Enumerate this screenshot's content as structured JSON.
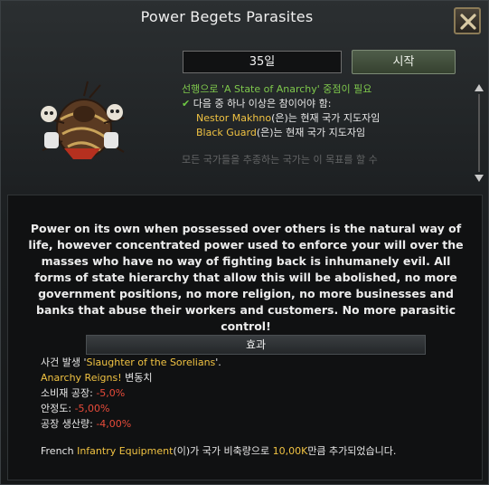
{
  "window": {
    "title": "Power Begets Parasites"
  },
  "header": {
    "days": "35일",
    "start_label": "시작"
  },
  "requirements": {
    "line1": "선행으로 'A State of Anarchy' 중점이 필요",
    "line2_check": "✔",
    "line2": "다음 중 하나 이상은 참이어야 함:",
    "cond1_name": "Nestor Makhno",
    "cond1_rest": "(은)는 현재 국가 지도자임",
    "cond2_name": "Black Guard",
    "cond2_rest": "(은)는 현재 국가 지도자임",
    "cut_text": "모든 국가들을 추종하는 국가는 이 목표를 할 수"
  },
  "description": "Power on its own when possessed over others is the natural way of life, however concentrated power used to enforce your will over the masses who have no way of fighting back is inhumanely evil. All forms of state hierarchy that allow this will be abolished, no more government positions, no more religion, no more businesses and banks that abuse their workers and customers. No more parasitic control!",
  "effects": {
    "header": "효과",
    "event_prefix": "사건 발생 '",
    "event_name": "Slaughter of the Sorelians",
    "event_suffix": "'.",
    "idea_name": "Anarchy Reigns!",
    "idea_suffix": " 변동치",
    "consumer_label": "소비재 공장: ",
    "consumer_value": "-5,0%",
    "stability_label": "안정도: ",
    "stability_value": "-5,00%",
    "factory_label": "공장 생산량: ",
    "factory_value": "-4,00%",
    "equip_prefix": "French ",
    "equip_name": "Infantry Equipment",
    "equip_mid": "(이)가 국가 비축량으로 ",
    "equip_amount": "10,00K",
    "equip_suffix": "만큼 추가되었습니다."
  },
  "colors": {
    "highlight": "#f0c242",
    "positive": "#7ec84c",
    "negative": "#e84b3a"
  }
}
